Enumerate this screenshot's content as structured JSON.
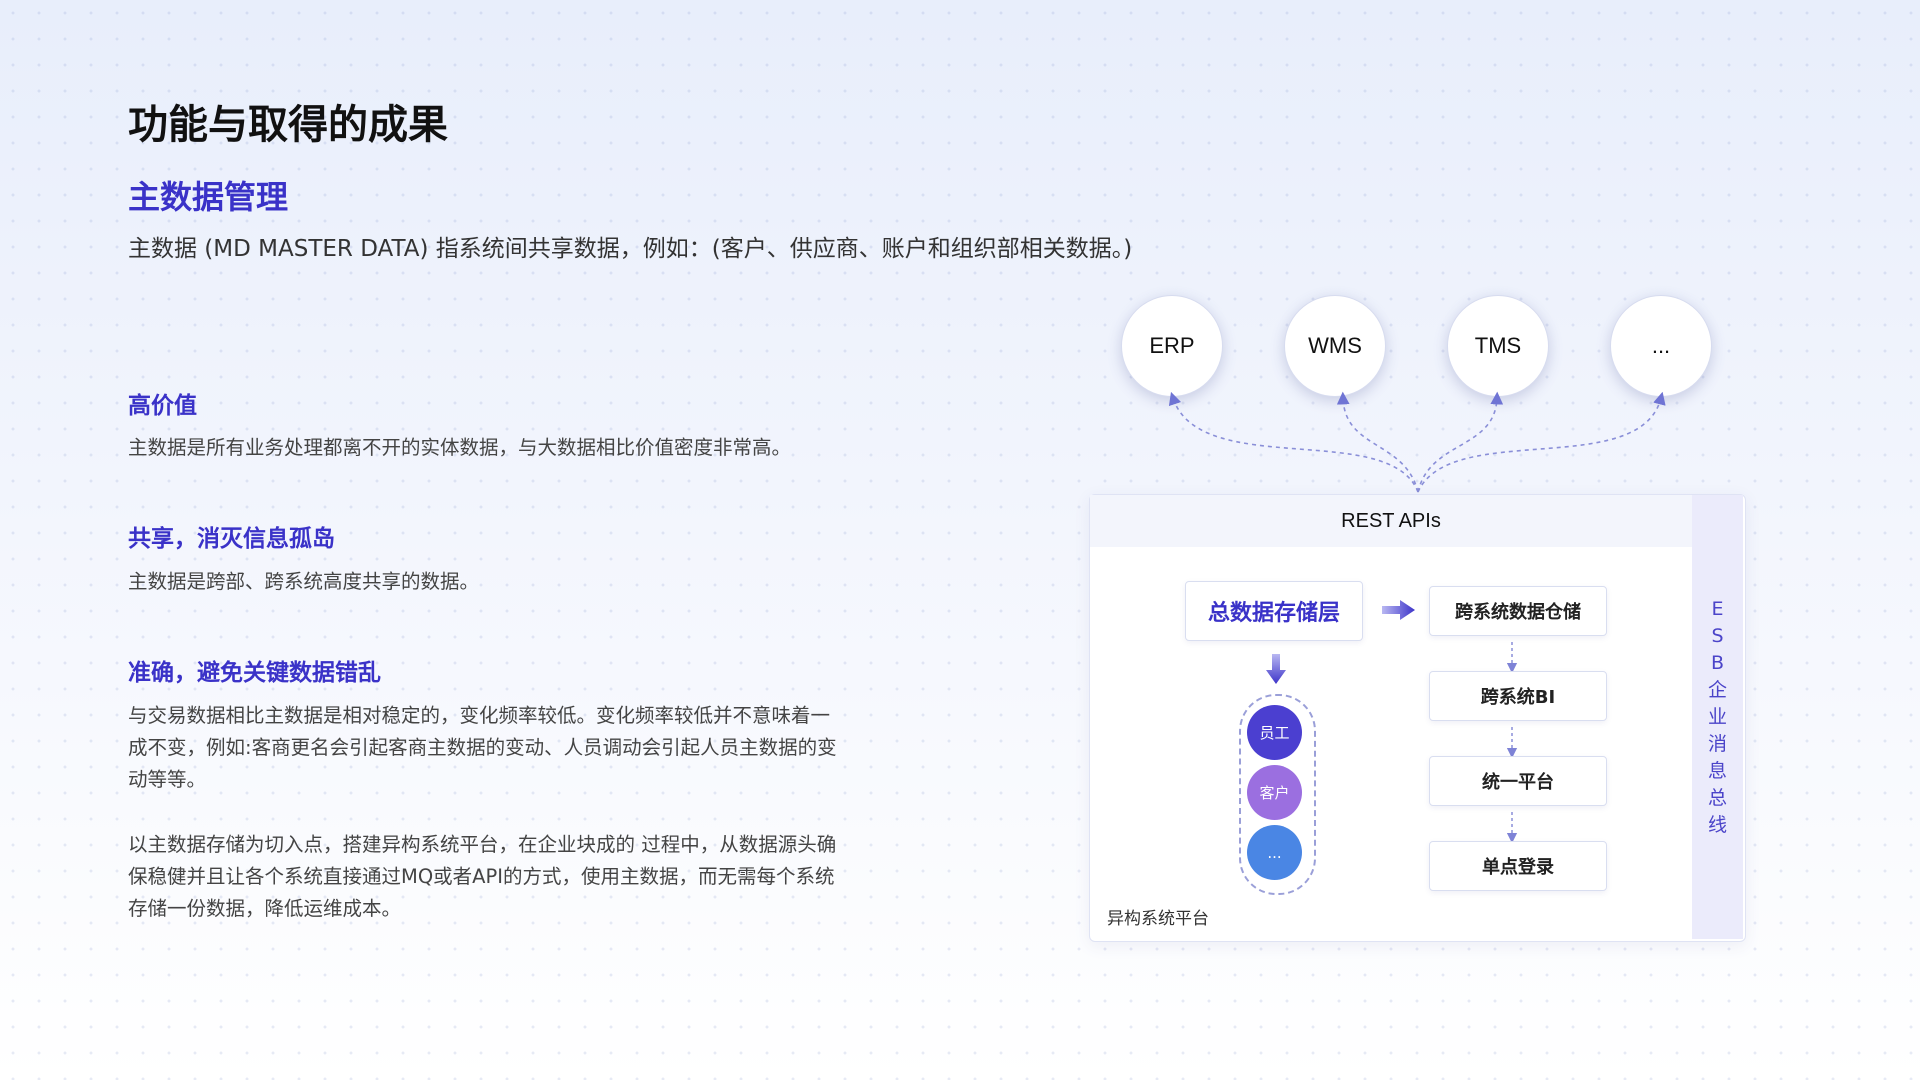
{
  "title": "功能与取得的成果",
  "subtitle": "主数据管理",
  "intro": "主数据 (MD MASTER DATA) 指系统间共享数据，例如：(客户、供应商、账户和组织部相关数据。)",
  "sections": [
    {
      "title": "高价值",
      "body": "主数据是所有业务处理都离不开的实体数据，与大数据相比价值密度非常高。"
    },
    {
      "title": "共享，消灭信息孤岛",
      "body": "主数据是跨部、跨系统高度共享的数据。"
    },
    {
      "title": "准确，避免关键数据错乱",
      "body": "与交易数据相比主数据是相对稳定的，变化频率较低。变化频率较低并不意味着一成不变，例如:客商更名会引起客商主数据的变动、人员调动会引起人员主数据的变动等等。"
    }
  ],
  "closing": "以主数据存储为切入点，搭建异构系统平台，在企业块成的 过程中，从数据源头确保稳健并且让各个系统直接通过MQ或者API的方式，使用主数据，而无需每个系统存储一份数据，降低运维成本。",
  "diagram": {
    "systems": [
      "ERP",
      "WMS",
      "TMS",
      "..."
    ],
    "rest_label": "REST APIs",
    "storage_label": "总数据存储层",
    "right_boxes": [
      "跨系统数据仓储",
      "跨系统BI",
      "统一平台",
      "单点登录"
    ],
    "entities": [
      {
        "label": "员工",
        "color": "#4b3fd0"
      },
      {
        "label": "客户",
        "color": "#9b6fe0"
      },
      {
        "label": "...",
        "color": "#4a86e4"
      }
    ],
    "platform_label": "异构系统平台",
    "esb_chars": [
      "E",
      "S",
      "B",
      "企",
      "业",
      "消",
      "息",
      "总",
      "线"
    ],
    "accent_color": "#3a32c8"
  }
}
